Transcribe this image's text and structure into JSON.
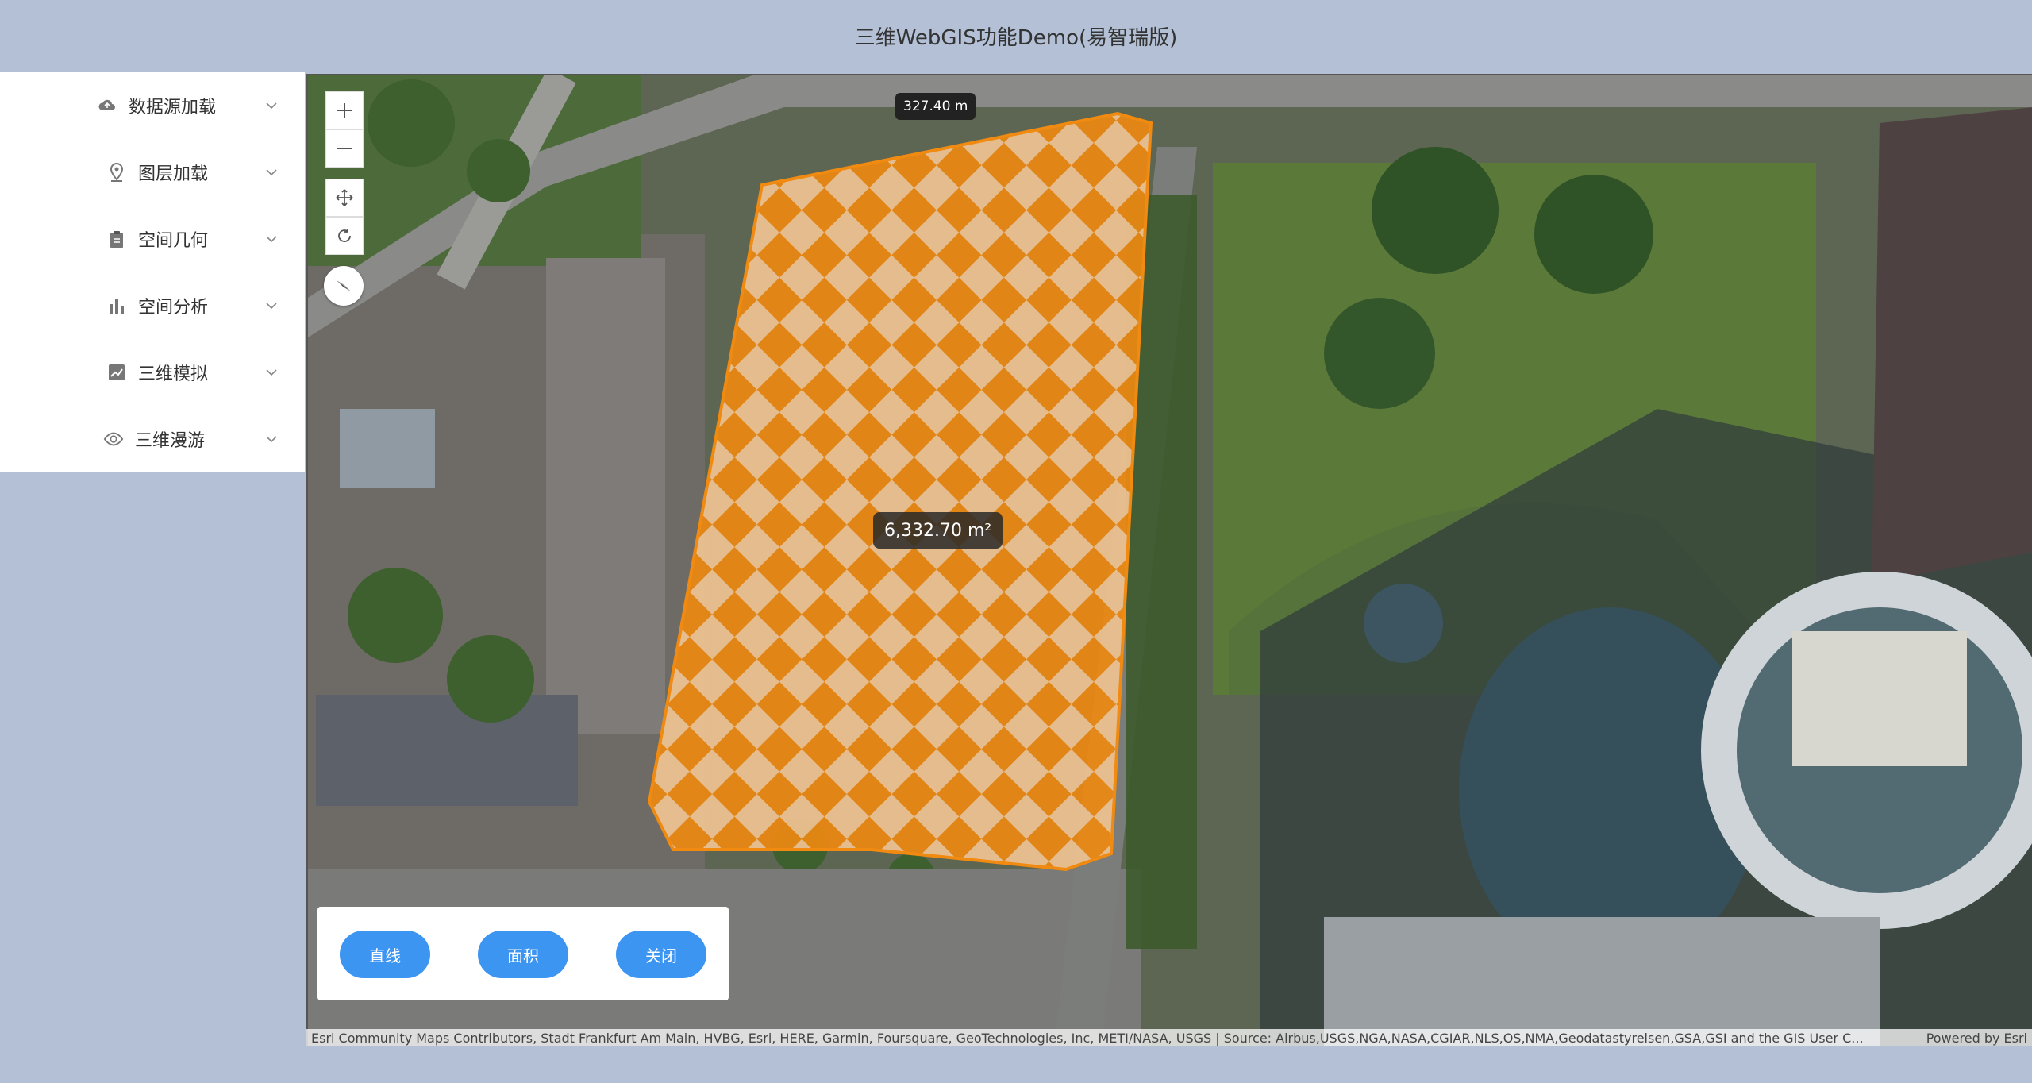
{
  "header": {
    "title": "三维WebGIS功能Demo(易智瑞版)"
  },
  "sidebar": {
    "items": [
      {
        "label": "数据源加载",
        "icon": "cloud-upload-icon"
      },
      {
        "label": "图层加载",
        "icon": "map-pin-icon"
      },
      {
        "label": "空间几何",
        "icon": "clipboard-icon"
      },
      {
        "label": "空间分析",
        "icon": "bar-chart-icon"
      },
      {
        "label": "三维模拟",
        "icon": "line-chart-icon"
      },
      {
        "label": "三维漫游",
        "icon": "eye-icon"
      }
    ]
  },
  "map": {
    "distance_label": "327.40 m",
    "area_label": "6,332.70 m²",
    "measure_color": "#f08a10",
    "attribution": "Esri Community Maps Contributors, Stadt Frankfurt Am Main, HVBG, Esri, HERE, Garmin, Foursquare, GeoTechnologies, Inc, METI/NASA, USGS | Source: Airbus,USGS,NGA,NASA,CGIAR,NLS,OS,NMA,Geodatastyrelsen,GSA,GSI and the GIS User C...",
    "powered_by": "Powered by Esri",
    "controls": [
      "zoom-in-icon",
      "zoom-out-icon",
      "pan-icon",
      "rotate-icon",
      "compass-icon"
    ]
  },
  "tools": {
    "line_label": "直线",
    "area_label": "面积",
    "close_label": "关闭",
    "button_color": "#3d95f2"
  }
}
